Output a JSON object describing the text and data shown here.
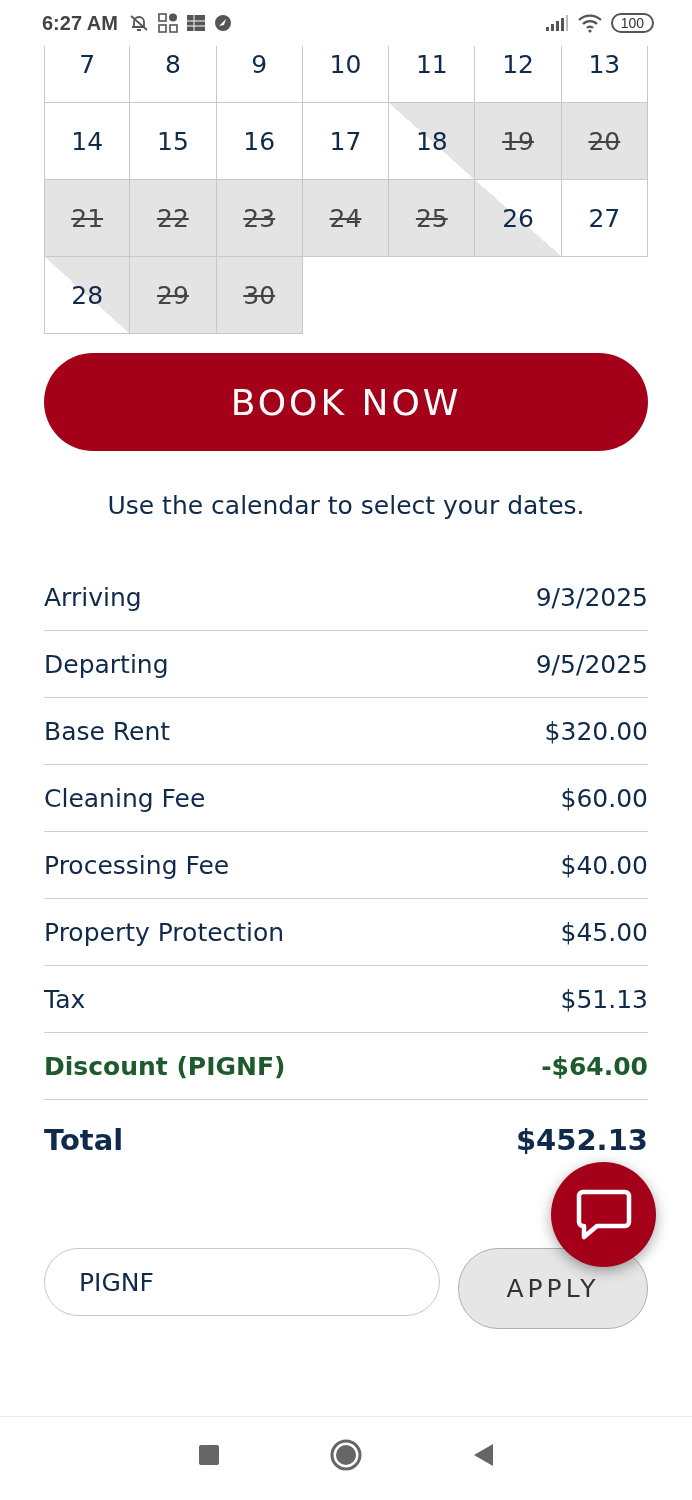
{
  "status_bar": {
    "time": "6:27 AM",
    "battery": "100"
  },
  "calendar": {
    "weeks": [
      [
        {
          "day": "7",
          "booked": false,
          "checkin_half": false,
          "checkout_half": false
        },
        {
          "day": "8",
          "booked": false,
          "checkin_half": false,
          "checkout_half": false
        },
        {
          "day": "9",
          "booked": false,
          "checkin_half": false,
          "checkout_half": false
        },
        {
          "day": "10",
          "booked": false,
          "checkin_half": false,
          "checkout_half": false
        },
        {
          "day": "11",
          "booked": false,
          "checkin_half": false,
          "checkout_half": false
        },
        {
          "day": "12",
          "booked": false,
          "checkin_half": false,
          "checkout_half": false
        },
        {
          "day": "13",
          "booked": false,
          "checkin_half": false,
          "checkout_half": false
        }
      ],
      [
        {
          "day": "14",
          "booked": false,
          "checkin_half": false,
          "checkout_half": false
        },
        {
          "day": "15",
          "booked": false,
          "checkin_half": false,
          "checkout_half": false
        },
        {
          "day": "16",
          "booked": false,
          "checkin_half": false,
          "checkout_half": false
        },
        {
          "day": "17",
          "booked": false,
          "checkin_half": false,
          "checkout_half": false
        },
        {
          "day": "18",
          "booked": false,
          "checkin_half": true,
          "checkout_half": false
        },
        {
          "day": "19",
          "booked": true,
          "checkin_half": false,
          "checkout_half": false
        },
        {
          "day": "20",
          "booked": true,
          "checkin_half": false,
          "checkout_half": false
        }
      ],
      [
        {
          "day": "21",
          "booked": true,
          "checkin_half": false,
          "checkout_half": false
        },
        {
          "day": "22",
          "booked": true,
          "checkin_half": false,
          "checkout_half": false
        },
        {
          "day": "23",
          "booked": true,
          "checkin_half": false,
          "checkout_half": false
        },
        {
          "day": "24",
          "booked": true,
          "checkin_half": false,
          "checkout_half": false
        },
        {
          "day": "25",
          "booked": true,
          "checkin_half": false,
          "checkout_half": false
        },
        {
          "day": "26",
          "booked": false,
          "checkin_half": false,
          "checkout_half": true
        },
        {
          "day": "27",
          "booked": false,
          "checkin_half": false,
          "checkout_half": false
        }
      ],
      [
        {
          "day": "28",
          "booked": false,
          "checkin_half": true,
          "checkout_half": false
        },
        {
          "day": "29",
          "booked": true,
          "checkin_half": false,
          "checkout_half": false
        },
        {
          "day": "30",
          "booked": true,
          "checkin_half": false,
          "checkout_half": false
        }
      ]
    ]
  },
  "book_button": "BOOK NOW",
  "hint": "Use the calendar to select your dates.",
  "summary": [
    {
      "label": "Arriving",
      "value": "9/3/2025",
      "kind": "plain"
    },
    {
      "label": "Departing",
      "value": "9/5/2025",
      "kind": "plain"
    },
    {
      "label": "Base Rent",
      "value": "$320.00",
      "kind": "plain"
    },
    {
      "label": "Cleaning Fee",
      "value": "$60.00",
      "kind": "plain"
    },
    {
      "label": "Processing Fee",
      "value": "$40.00",
      "kind": "plain"
    },
    {
      "label": "Property Protection",
      "value": "$45.00",
      "kind": "plain"
    },
    {
      "label": "Tax",
      "value": "$51.13",
      "kind": "plain"
    },
    {
      "label": "Discount (PIGNF)",
      "value": "-$64.00",
      "kind": "discount"
    },
    {
      "label": "Total",
      "value": "$452.13",
      "kind": "total"
    }
  ],
  "promo": {
    "value": "PIGNF",
    "button": "APPLY"
  }
}
